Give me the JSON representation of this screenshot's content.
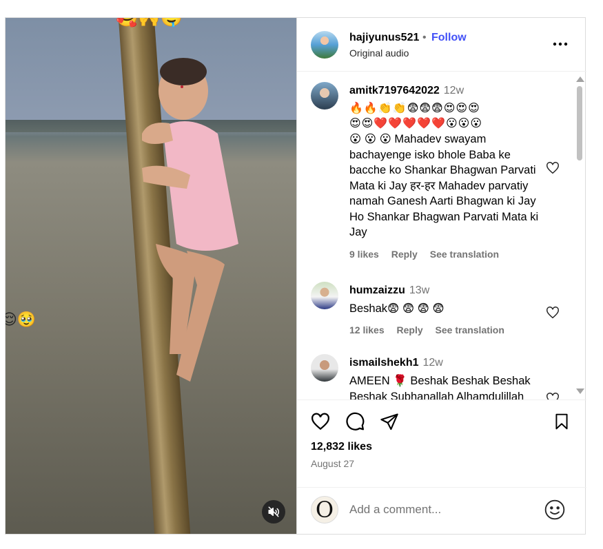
{
  "header": {
    "username": "hajiyunus521",
    "separator": "•",
    "follow_label": "Follow",
    "subtitle": "Original audio",
    "more_icon": "more-horizontal-icon"
  },
  "media": {
    "emoji_top": "🥰🙌🤤",
    "emoji_left": "😌🥹",
    "mute_icon": "speaker-muted-icon"
  },
  "comments": [
    {
      "username": "amitk7197642022",
      "time": "12w",
      "emoji_line1": "🔥🔥👏👏😨😨😨😍😍😍",
      "emoji_line2": "😍😍❤️❤️❤️❤️❤️😮😮😮",
      "text": "😮 😮 😮 Mahadev swayam bachayenge isko bhole Baba ke bacche ko Shankar Bhagwan Parvati Mata ki Jay हर-हर Mahadev parvatiy namah Ganesh Aarti Bhagwan ki Jay Ho Shankar Bhagwan Parvati Mata ki Jay",
      "likes": "9 likes",
      "reply": "Reply",
      "translate": "See translation"
    },
    {
      "username": "humzaizzu",
      "time": "13w",
      "text": "Beshak😨 😨 😨 😨",
      "likes": "12 likes",
      "reply": "Reply",
      "translate": "See translation"
    },
    {
      "username": "ismailshekh1",
      "time": "12w",
      "text": "AMEEN 🌹 Beshak Beshak Beshak Beshak Subhanallah Alhamdulillah"
    }
  ],
  "actions": {
    "likes": "12,832 likes",
    "date": "August 27",
    "comment_placeholder": "Add a comment...",
    "avatar_letter": "O"
  }
}
